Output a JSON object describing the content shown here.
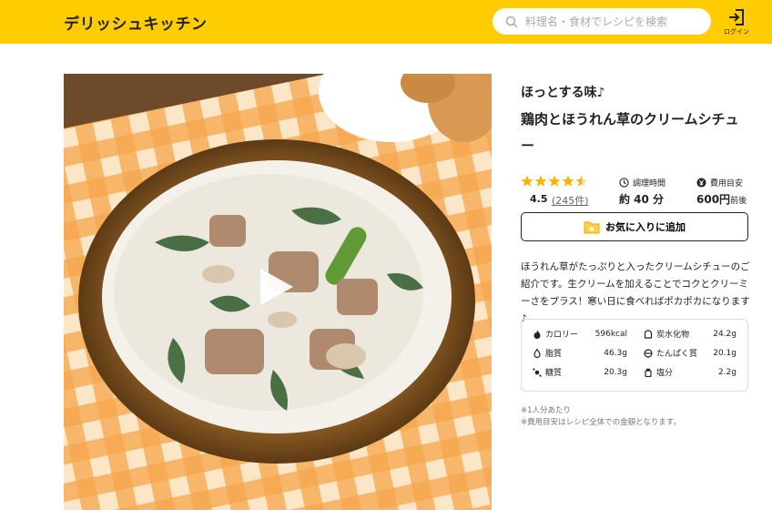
{
  "header": {
    "logo": "デリッシュキッチン",
    "search_placeholder": "料理名・食材でレシピを検索",
    "login_label": "ログイン",
    "accent_color": "#ffcc00"
  },
  "recipe": {
    "catch_copy": "ほっとする味♪",
    "title": "鶏肉とほうれん草のクリームシチュー",
    "rating": {
      "value": "4.5",
      "count": "(245件)",
      "stars": 4.5
    },
    "cook_time": {
      "label": "調理時間",
      "value": "約 40 分"
    },
    "cost": {
      "label": "費用目安",
      "value": "600円",
      "suffix": "前後"
    },
    "favorite_button": "お気に入りに追加",
    "description": "ほうれん草がたっぷりと入ったクリームシチューのご紹介です。生クリームを加えることでコクとクリーミーさをプラス！寒い日に食べればポカポカになります♪",
    "nutrition": [
      {
        "icon": "fire-icon",
        "label": "カロリー",
        "value": "596kcal"
      },
      {
        "icon": "bread-icon",
        "label": "炭水化物",
        "value": "24.2g"
      },
      {
        "icon": "drop-icon",
        "label": "脂質",
        "value": "46.3g"
      },
      {
        "icon": "protein-icon",
        "label": "たんぱく質",
        "value": "20.1g"
      },
      {
        "icon": "candy-icon",
        "label": "糖質",
        "value": "20.3g"
      },
      {
        "icon": "salt-icon",
        "label": "塩分",
        "value": "2.2g"
      }
    ],
    "notes": [
      "※1人分あたり",
      "※費用目安はレシピ全体での金額となります。"
    ]
  }
}
